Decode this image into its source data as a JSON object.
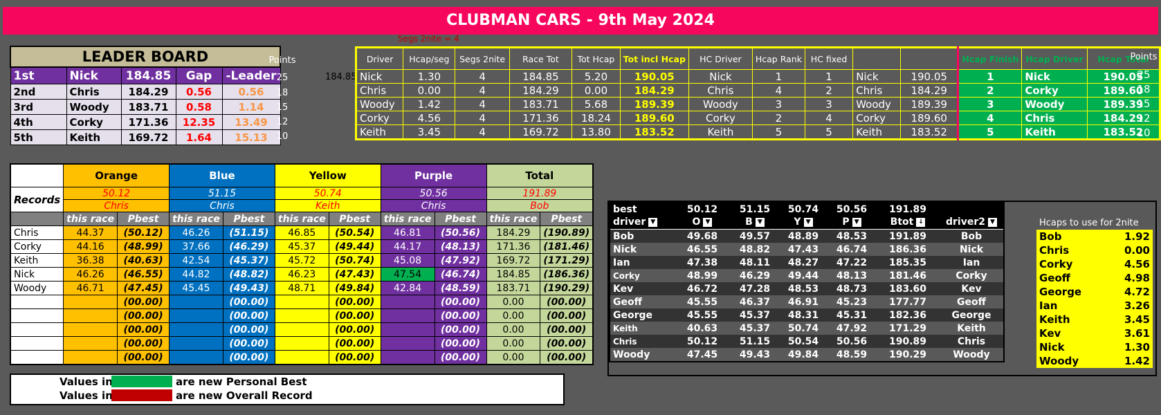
{
  "title": "CLUBMAN CARS - 9th May 2024",
  "segs_note": "Segs 2nite =     4",
  "leaderboard": {
    "title": "LEADER BOARD",
    "points_label": "Points",
    "header": [
      "1st",
      "Nick",
      "184.85",
      "Gap",
      "-Leader"
    ],
    "header_points": "25",
    "rows": [
      {
        "pos": "2nd",
        "name": "Chris",
        "score": "184.29",
        "gap": "0.56",
        "leader": "0.56",
        "points": "18"
      },
      {
        "pos": "3rd",
        "name": "Woody",
        "score": "183.71",
        "gap": "0.58",
        "leader": "1.14",
        "points": "15"
      },
      {
        "pos": "4th",
        "name": "Corky",
        "score": "171.36",
        "gap": "12.35",
        "leader": "13.49",
        "points": "12"
      },
      {
        "pos": "5th",
        "name": "Keith",
        "score": "169.72",
        "gap": "1.64",
        "leader": "15.13",
        "points": "10"
      }
    ]
  },
  "side_value": "184.85",
  "race": {
    "headers": [
      "Driver",
      "Hcap/seg",
      "Segs 2nite",
      "Race Tot",
      "Tot Hcap",
      "Tot incl Hcap",
      "HC Driver",
      "Hcap Rank",
      "HC fixed",
      "",
      "",
      "Hcap Finish",
      "Hcap Driver",
      "Hcap Total"
    ],
    "points_label": "Points",
    "rows": [
      [
        "Nick",
        "1.30",
        "4",
        "184.85",
        "5.20",
        "190.05",
        "Nick",
        "1",
        "1",
        "Nick",
        "190.05",
        "1",
        "Nick",
        "190.05",
        "25"
      ],
      [
        "Chris",
        "0.00",
        "4",
        "184.29",
        "0.00",
        "184.29",
        "Chris",
        "4",
        "2",
        "Chris",
        "184.29",
        "2",
        "Corky",
        "189.60",
        "18"
      ],
      [
        "Woody",
        "1.42",
        "4",
        "183.71",
        "5.68",
        "189.39",
        "Woody",
        "3",
        "3",
        "Woody",
        "189.39",
        "3",
        "Woody",
        "189.39",
        "15"
      ],
      [
        "Corky",
        "4.56",
        "4",
        "171.36",
        "18.24",
        "189.60",
        "Corky",
        "2",
        "4",
        "Corky",
        "189.60",
        "4",
        "Chris",
        "184.29",
        "12"
      ],
      [
        "Keith",
        "3.45",
        "4",
        "169.72",
        "13.80",
        "183.52",
        "Keith",
        "5",
        "5",
        "Keith",
        "183.52",
        "5",
        "Keith",
        "183.52",
        "10"
      ]
    ]
  },
  "records": {
    "colors": [
      "Orange",
      "Blue",
      "Yellow",
      "Purple",
      "Total"
    ],
    "label": "Records",
    "record_values": [
      "50.12",
      "51.15",
      "50.74",
      "50.56",
      "191.89"
    ],
    "record_holders": [
      "Chris",
      "Chris",
      "Keith",
      "Chris",
      "Bob"
    ],
    "sub": [
      "this race",
      "Pbest"
    ],
    "rows": [
      [
        "Chris",
        "44.37",
        "(50.12)",
        "46.26",
        "(51.15)",
        "46.85",
        "(50.54)",
        "46.81",
        "(50.56)",
        "184.29",
        "(190.89)"
      ],
      [
        "Corky",
        "44.16",
        "(48.99)",
        "37.66",
        "(46.29)",
        "45.37",
        "(49.44)",
        "44.17",
        "(48.13)",
        "171.36",
        "(181.46)"
      ],
      [
        "Keith",
        "36.38",
        "(40.63)",
        "42.54",
        "(45.37)",
        "45.72",
        "(50.74)",
        "45.08",
        "(47.92)",
        "169.72",
        "(171.29)"
      ],
      [
        "Nick",
        "46.26",
        "(46.55)",
        "44.82",
        "(48.82)",
        "46.23",
        "(47.43)",
        "47.54",
        "(46.74)",
        "184.85",
        "(186.36)"
      ],
      [
        "Woody",
        "46.71",
        "(47.45)",
        "45.45",
        "(49.43)",
        "48.71",
        "(49.84)",
        "42.84",
        "(48.59)",
        "183.71",
        "(190.29)"
      ],
      [
        "",
        "",
        "(00.00)",
        "",
        "(00.00)",
        "",
        "(00.00)",
        "",
        "(00.00)",
        "0.00",
        "(00.00)"
      ],
      [
        "",
        "",
        "(00.00)",
        "",
        "(00.00)",
        "",
        "(00.00)",
        "",
        "(00.00)",
        "0.00",
        "(00.00)"
      ],
      [
        "",
        "",
        "(00.00)",
        "",
        "(00.00)",
        "",
        "(00.00)",
        "",
        "(00.00)",
        "0.00",
        "(00.00)"
      ],
      [
        "",
        "",
        "(00.00)",
        "",
        "(00.00)",
        "",
        "(00.00)",
        "",
        "(00.00)",
        "0.00",
        "(00.00)"
      ],
      [
        "",
        "",
        "(00.00)",
        "",
        "(00.00)",
        "",
        "(00.00)",
        "",
        "(00.00)",
        "0.00",
        "(00.00)"
      ]
    ]
  },
  "legend": {
    "values_in": "Values in",
    "pb_text": "are new Personal Best",
    "rec_text": "are new Overall Record",
    "pb_color": "#00b050",
    "rec_color": "#c00000"
  },
  "best": {
    "title": "best",
    "title_values": [
      "50.12",
      "51.15",
      "50.74",
      "50.56",
      "191.89"
    ],
    "headers": [
      "driver",
      "O",
      "B",
      "Y",
      "P",
      "Btot",
      "driver2"
    ],
    "rows": [
      [
        "Bob",
        "49.68",
        "49.57",
        "48.89",
        "48.53",
        "191.89",
        "Bob"
      ],
      [
        "Nick",
        "46.55",
        "48.82",
        "47.43",
        "46.74",
        "186.36",
        "Nick"
      ],
      [
        "Ian",
        "47.38",
        "48.11",
        "48.27",
        "47.22",
        "185.35",
        "Ian"
      ],
      [
        "Corky",
        "48.99",
        "46.29",
        "49.44",
        "48.13",
        "181.46",
        "Corky"
      ],
      [
        "Kev",
        "46.72",
        "47.28",
        "48.53",
        "48.73",
        "183.60",
        "Kev"
      ],
      [
        "Geoff",
        "45.55",
        "46.37",
        "46.91",
        "45.23",
        "177.77",
        "Geoff"
      ],
      [
        "George",
        "45.55",
        "45.37",
        "48.31",
        "45.31",
        "182.36",
        "George"
      ],
      [
        "Keith",
        "40.63",
        "45.37",
        "50.74",
        "47.92",
        "171.29",
        "Keith"
      ],
      [
        "Chris",
        "50.12",
        "51.15",
        "50.54",
        "50.56",
        "190.89",
        "Chris"
      ],
      [
        "Woody",
        "47.45",
        "49.43",
        "49.84",
        "48.59",
        "190.29",
        "Woody"
      ]
    ]
  },
  "hcaps": {
    "label": "Hcaps to use for 2nite",
    "rows": [
      [
        "Bob",
        "1.92"
      ],
      [
        "Chris",
        "0.00"
      ],
      [
        "Corky",
        "4.56"
      ],
      [
        "Geoff",
        "4.98"
      ],
      [
        "George",
        "4.72"
      ],
      [
        "Ian",
        "3.26"
      ],
      [
        "Keith",
        "3.45"
      ],
      [
        "Kev",
        "3.61"
      ],
      [
        "Nick",
        "1.30"
      ],
      [
        "Woody",
        "1.42"
      ]
    ]
  }
}
